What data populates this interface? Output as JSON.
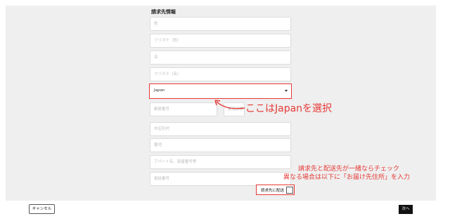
{
  "form": {
    "title": "請求先情報",
    "fields": [
      {
        "placeholder": "姓"
      },
      {
        "placeholder": "フリガナ（姓）"
      },
      {
        "placeholder": "名"
      },
      {
        "placeholder": "フリガナ（名）"
      },
      {
        "placeholder": "郵便番号"
      },
      {
        "placeholder": "都道府県"
      },
      {
        "placeholder": "市区町村"
      },
      {
        "placeholder": "番地"
      },
      {
        "placeholder": "アパート名、部屋番号等"
      },
      {
        "placeholder": "電話番号"
      }
    ],
    "country": {
      "value": "Japan"
    },
    "billing_same_checkbox": {
      "label": "請求先に配送",
      "checked": false
    }
  },
  "annotations": {
    "country_note": "ここはJapanを選択",
    "checkbox_note_line1": "請求先と配送先が一緒ならチェック",
    "checkbox_note_line2": "異なる場合は以下に「お届け先住所」を入力",
    "color": "#e53935"
  },
  "footer": {
    "cancel_label": "キャンセル",
    "next_label": "次へ"
  }
}
